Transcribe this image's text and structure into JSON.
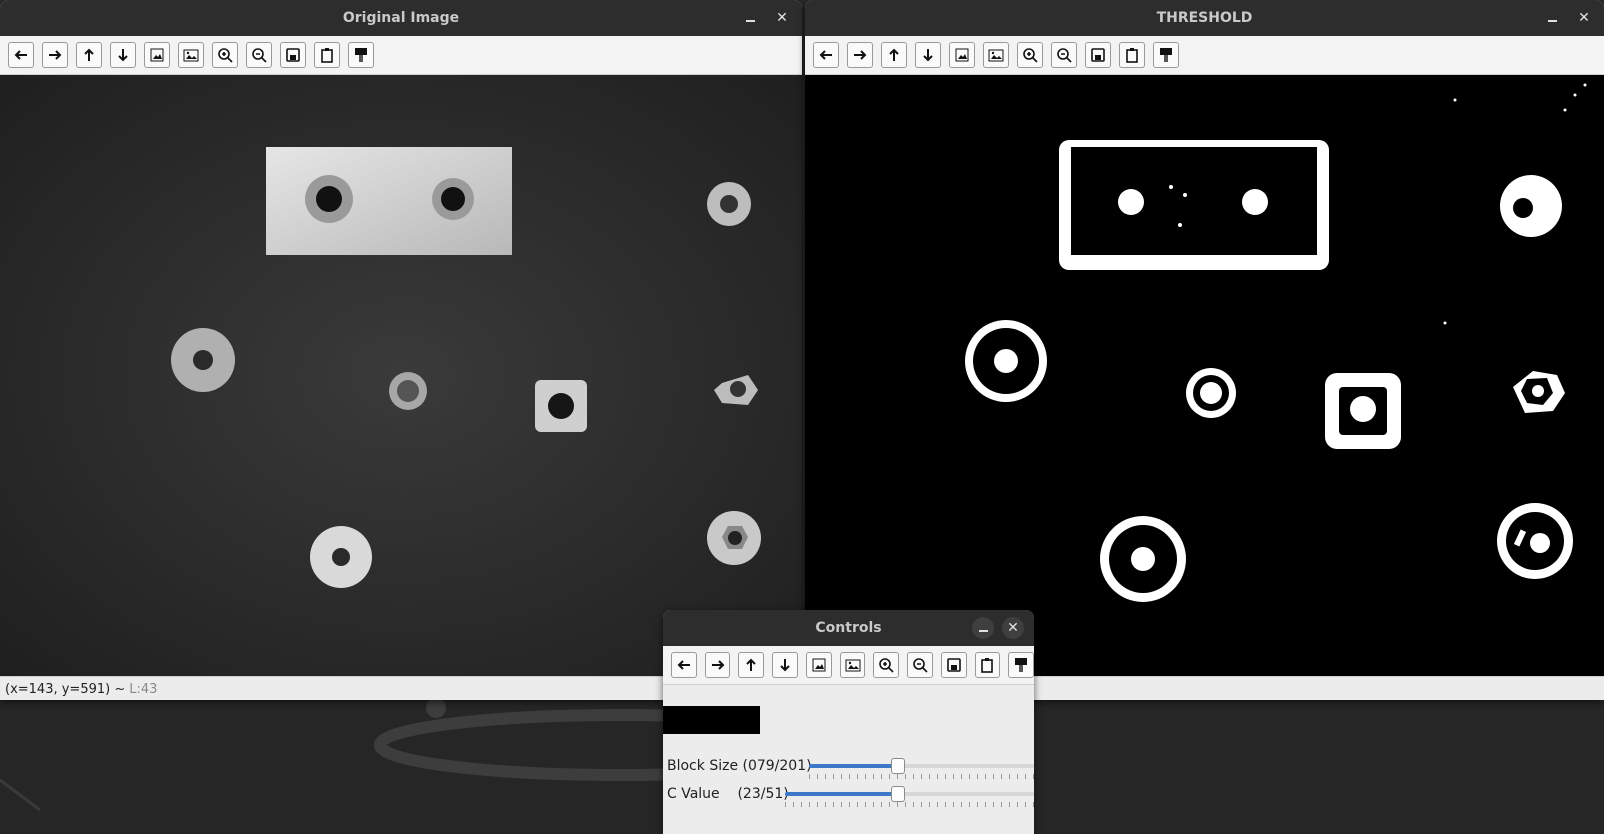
{
  "windows": {
    "original": {
      "title": "Original Image"
    },
    "threshold": {
      "title": "THRESHOLD"
    },
    "controls": {
      "title": "Controls"
    }
  },
  "toolbar": {
    "icons": [
      "arrow-left-icon",
      "arrow-right-icon",
      "arrow-up-icon",
      "arrow-down-icon",
      "image-icon",
      "image-alt-icon",
      "zoom-in-icon",
      "zoom-out-icon",
      "save-icon",
      "clipboard-icon",
      "properties-icon"
    ]
  },
  "status": {
    "coords": "(x=143, y=591) ~",
    "lvalue": "L:43"
  },
  "sliders": {
    "block_size": {
      "label": "Block Size (079/201)",
      "value": 79,
      "max": 201
    },
    "c_value": {
      "label": "C Value    (23/51)",
      "value": 23,
      "max": 51
    }
  },
  "colors": {
    "accent": "#3c78c8",
    "titlebar": "#2d2d2d"
  }
}
